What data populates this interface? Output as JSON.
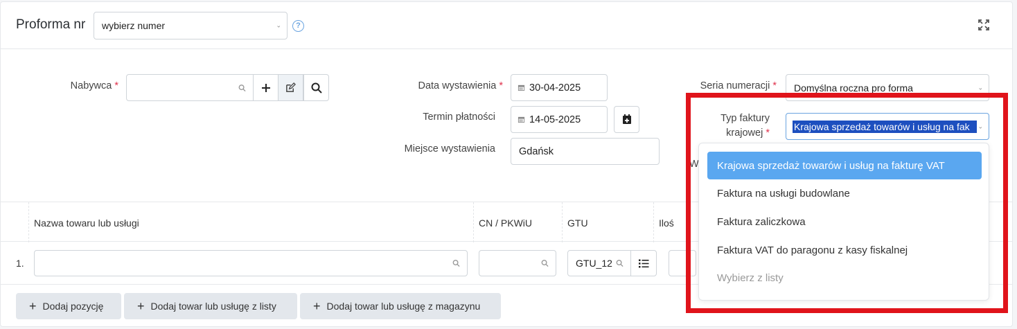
{
  "header": {
    "title": "Proforma nr",
    "number_select": "wybierz numer"
  },
  "form": {
    "buyer_label": "Nabywca",
    "buyer_value": "",
    "issue_date_label": "Data wystawienia",
    "issue_date_value": "30-04-2025",
    "due_label": "Termin płatności",
    "due_value": "14-05-2025",
    "place_label": "Miejsce wystawienia",
    "place_value": "Gdańsk",
    "series_label": "Seria numeracji",
    "series_value": "Domyślna roczna pro forma",
    "type_label_line1": "Typ faktury",
    "type_label_line2": "krajowej",
    "type_value": "Krajowa sprzedaż towarów i usług na fak",
    "partial_label": "W",
    "required_mark": "*"
  },
  "dropdown": {
    "options": [
      "Krajowa sprzedaż towarów i usług na fakturę VAT",
      "Faktura na usługi budowlane",
      "Faktura zaliczkowa",
      "Faktura VAT do paragonu z kasy fiskalnej",
      "Wybierz z listy"
    ]
  },
  "table": {
    "columns": [
      "Nazwa towaru lub usługi",
      "CN / PKWiU",
      "GTU",
      "Iloś"
    ],
    "row": {
      "index": "1.",
      "gtu_value": "GTU_12"
    }
  },
  "actions": {
    "add_position": "Dodaj pozycję",
    "add_from_list": "Dodaj towar lub usługę z listy",
    "add_from_warehouse": "Dodaj towar lub usługę z magazynu"
  },
  "colors": {
    "accent": "#5aa7f0",
    "highlight_box": "#e0141b",
    "required": "#e0334d"
  }
}
